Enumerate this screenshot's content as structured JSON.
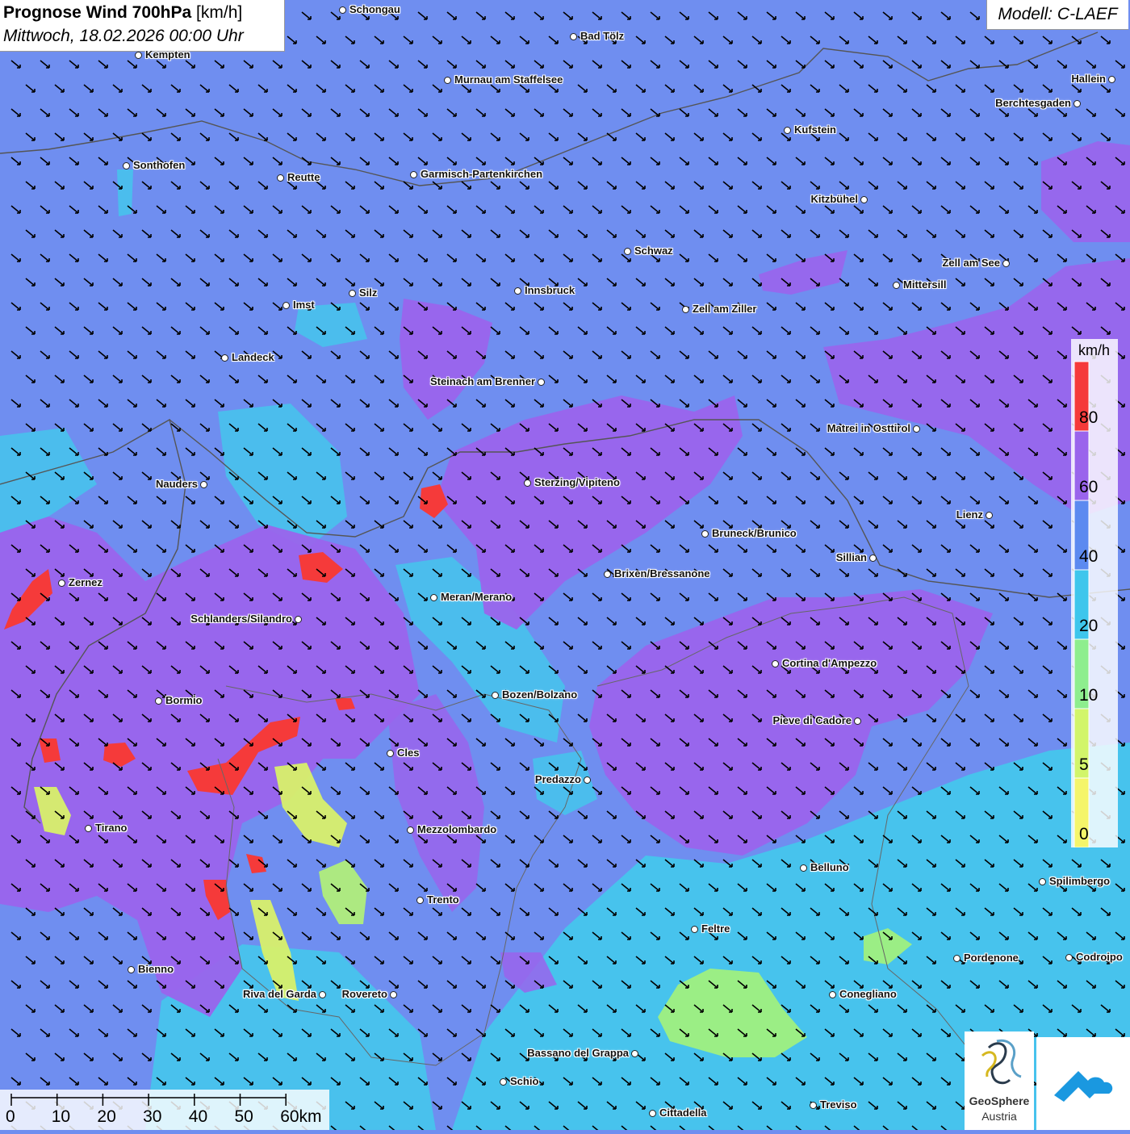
{
  "title": {
    "bold": "Prognose Wind 700hPa",
    "unit": "[km/h]",
    "date": "Mittwoch, 18.02.2026 00:00 Uhr"
  },
  "model": "Modell: C-LAEF",
  "legend": {
    "unit": "km/h",
    "ticks": [
      "80",
      "60",
      "40",
      "20",
      "10",
      "5",
      "0"
    ],
    "colors": [
      "#f53a3a",
      "#9a64ec",
      "#5c8af0",
      "#3ec6ec",
      "#8eee8e",
      "#d2f56a",
      "#f5f56a"
    ]
  },
  "scalebar": {
    "labels": [
      "0",
      "10",
      "20",
      "30",
      "40",
      "50",
      "60km"
    ]
  },
  "logos": {
    "geosphere_line1": "GeoSphere",
    "geosphere_line2": "Austria"
  },
  "wind": {
    "direction": "from north-west",
    "arrow_color": "#000000"
  },
  "cities": [
    {
      "name": "Schongau",
      "side": "right"
    },
    {
      "name": "Bad Tölz",
      "side": "right"
    },
    {
      "name": "Kempten",
      "side": "right"
    },
    {
      "name": "Murnau am Staffelsee",
      "side": "right"
    },
    {
      "name": "Hallein",
      "side": "left"
    },
    {
      "name": "Berchtesgaden",
      "side": "left"
    },
    {
      "name": "Kufstein",
      "side": "right"
    },
    {
      "name": "Sonthofen",
      "side": "right"
    },
    {
      "name": "Reutte",
      "side": "right"
    },
    {
      "name": "Garmisch-Partenkirchen",
      "side": "right"
    },
    {
      "name": "Kitzbühel",
      "side": "left"
    },
    {
      "name": "Schwaz",
      "side": "right"
    },
    {
      "name": "Zell am See",
      "side": "left"
    },
    {
      "name": "Innsbruck",
      "side": "right"
    },
    {
      "name": "Mittersill",
      "side": "right"
    },
    {
      "name": "Silz",
      "side": "right"
    },
    {
      "name": "Imst",
      "side": "right"
    },
    {
      "name": "Zell am Ziller",
      "side": "right"
    },
    {
      "name": "Landeck",
      "side": "right"
    },
    {
      "name": "Steinach am Brenner",
      "side": "left"
    },
    {
      "name": "Matrei in Osttirol",
      "side": "left"
    },
    {
      "name": "Nauders",
      "side": "left"
    },
    {
      "name": "Sterzing/Vipiteno",
      "side": "right"
    },
    {
      "name": "Lienz",
      "side": "left"
    },
    {
      "name": "Bruneck/Brunico",
      "side": "right"
    },
    {
      "name": "Sillian",
      "side": "left"
    },
    {
      "name": "Zernez",
      "side": "right"
    },
    {
      "name": "Brixen/Bressanone",
      "side": "right"
    },
    {
      "name": "Meran/Merano",
      "side": "right"
    },
    {
      "name": "Schlanders/Silandro",
      "side": "left"
    },
    {
      "name": "Cortina d'Ampezzo",
      "side": "right"
    },
    {
      "name": "Bozen/Bolzano",
      "side": "right"
    },
    {
      "name": "Bormio",
      "side": "right"
    },
    {
      "name": "Pieve di Cadore",
      "side": "left"
    },
    {
      "name": "Cles",
      "side": "right"
    },
    {
      "name": "Predazzo",
      "side": "left"
    },
    {
      "name": "Tirano",
      "side": "right"
    },
    {
      "name": "Mezzolombardo",
      "side": "right"
    },
    {
      "name": "Belluno",
      "side": "right"
    },
    {
      "name": "Spilimbergo",
      "side": "right"
    },
    {
      "name": "Trento",
      "side": "right"
    },
    {
      "name": "Feltre",
      "side": "right"
    },
    {
      "name": "Pordenone",
      "side": "right"
    },
    {
      "name": "Codroipo",
      "side": "right"
    },
    {
      "name": "Bienno",
      "side": "right"
    },
    {
      "name": "Riva del Garda",
      "side": "left"
    },
    {
      "name": "Rovereto",
      "side": "left"
    },
    {
      "name": "Conegliano",
      "side": "right"
    },
    {
      "name": "Bassano del Grappa",
      "side": "left"
    },
    {
      "name": "Schio",
      "side": "right"
    },
    {
      "name": "Treviso",
      "side": "right"
    },
    {
      "name": "Cittadella",
      "side": "right"
    }
  ]
}
